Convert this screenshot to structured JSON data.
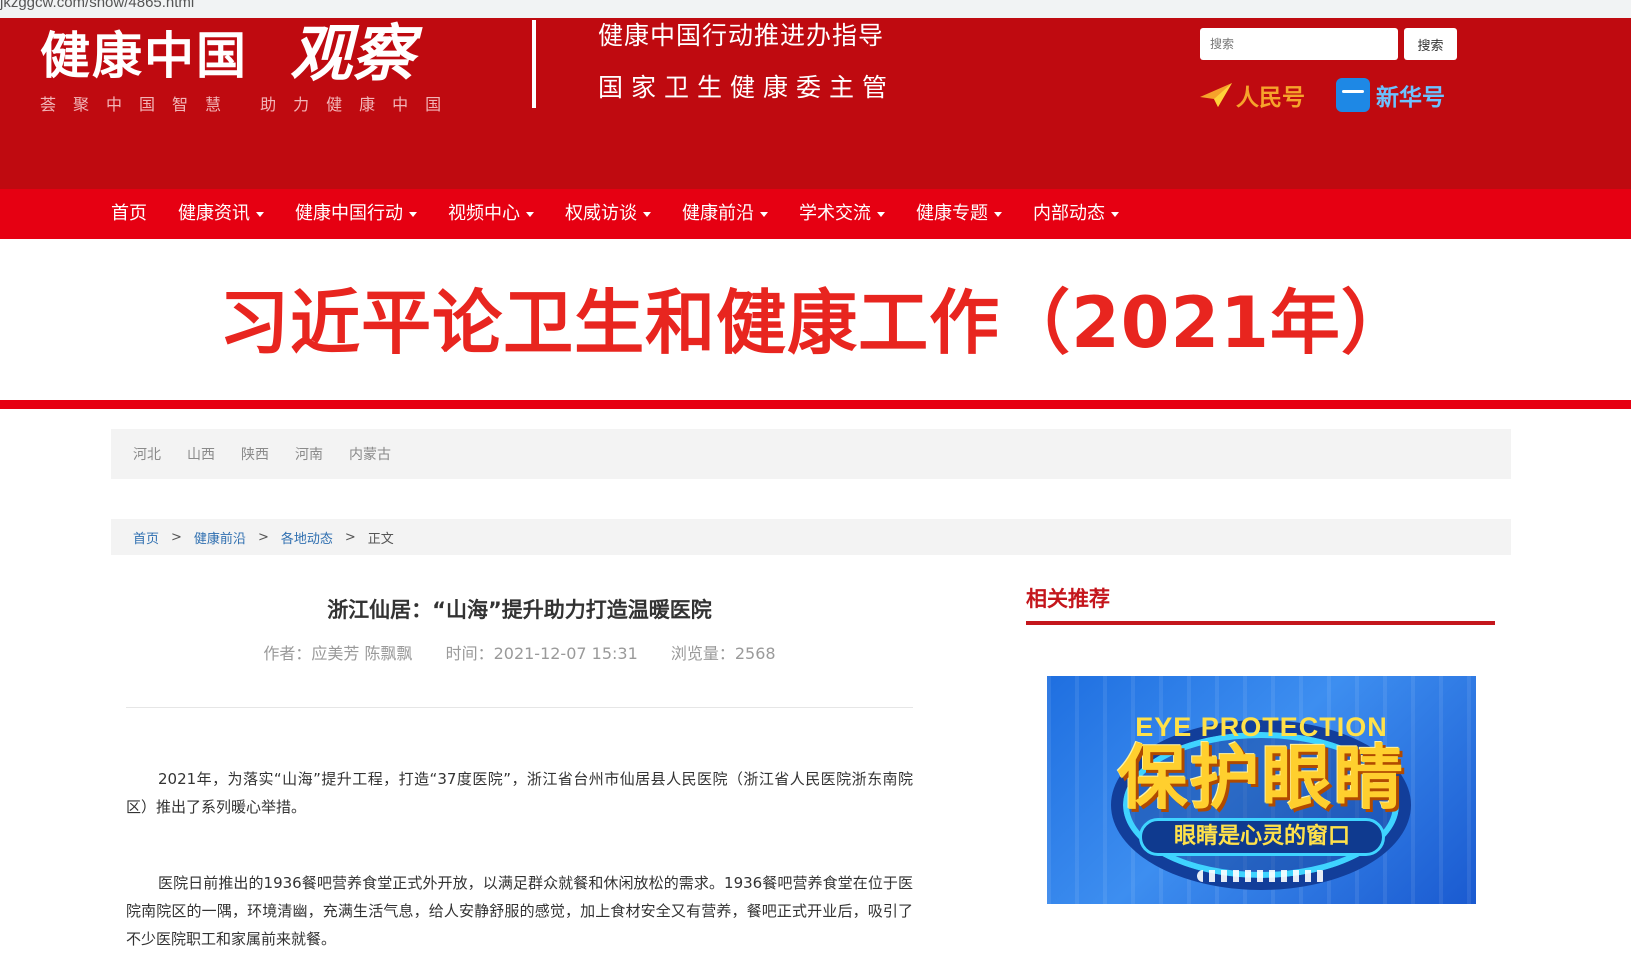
{
  "browser": {
    "url": "jkzggcw.com/show/4865.html"
  },
  "header": {
    "logo_main": "健康中国",
    "logo_script": "观察",
    "logo_tagline": "荟聚中国智慧  助力健康中国",
    "guide_line_1": "健康中国行动推进办指导",
    "guide_line_2": "国家卫生健康委主管",
    "search": {
      "placeholder": "搜索",
      "button_label": "搜索"
    },
    "platforms": [
      {
        "name": "人民号",
        "icon": "renminhao-logo-icon",
        "color": "#f6a32b"
      },
      {
        "name": "新华号",
        "icon": "xinhuahao-logo-icon",
        "color": "#1e88e5"
      }
    ]
  },
  "nav": {
    "items": [
      {
        "label": "首页",
        "dropdown": false
      },
      {
        "label": "健康资讯",
        "dropdown": true
      },
      {
        "label": "健康中国行动",
        "dropdown": true
      },
      {
        "label": "视频中心",
        "dropdown": true
      },
      {
        "label": "权威访谈",
        "dropdown": true
      },
      {
        "label": "健康前沿",
        "dropdown": true
      },
      {
        "label": "学术交流",
        "dropdown": true
      },
      {
        "label": "健康专题",
        "dropdown": true
      },
      {
        "label": "内部动态",
        "dropdown": true
      }
    ]
  },
  "banner": {
    "title": "习近平论卫生和健康工作（2021年）"
  },
  "regions": [
    "河北",
    "山西",
    "陕西",
    "河南",
    "内蒙古"
  ],
  "breadcrumb": {
    "items": [
      "首页",
      "健康前沿",
      "各地动态"
    ],
    "separator": ">",
    "current": "正文"
  },
  "article": {
    "title": "浙江仙居：“山海”提升助力打造温暖医院",
    "author": "作者：应美芳 陈飘飘",
    "time": "时间：2021-12-07 15:31",
    "views": "浏览量：2568",
    "paragraphs": [
      "2021年，为落实“山海”提升工程，打造“37度医院”，浙江省台州市仙居县人民医院（浙江省人民医院浙东南院区）推出了系列暖心举措。",
      "医院日前推出的1936餐吧营养食堂正式外开放，以满足群众就餐和休闲放松的需求。1936餐吧营养食堂在位于医院南院区的一隅，环境清幽，充满生活气息，给人安静舒服的感觉，加上食材安全又有营养，餐吧正式开业后，吸引了不少医院职工和家属前来就餐。"
    ]
  },
  "sidebar": {
    "title": "相关推荐",
    "promo": {
      "eyebrow": "EYE PROTECTION",
      "headline": "保护眼睛",
      "subline": "眼睛是心灵的窗口"
    }
  },
  "colors": {
    "header_red": "#bf0a10",
    "nav_red": "#e60012",
    "banner_title": "#e8251f",
    "link_blue": "#2f6fb0",
    "sidebar_accent": "#c4161c"
  }
}
